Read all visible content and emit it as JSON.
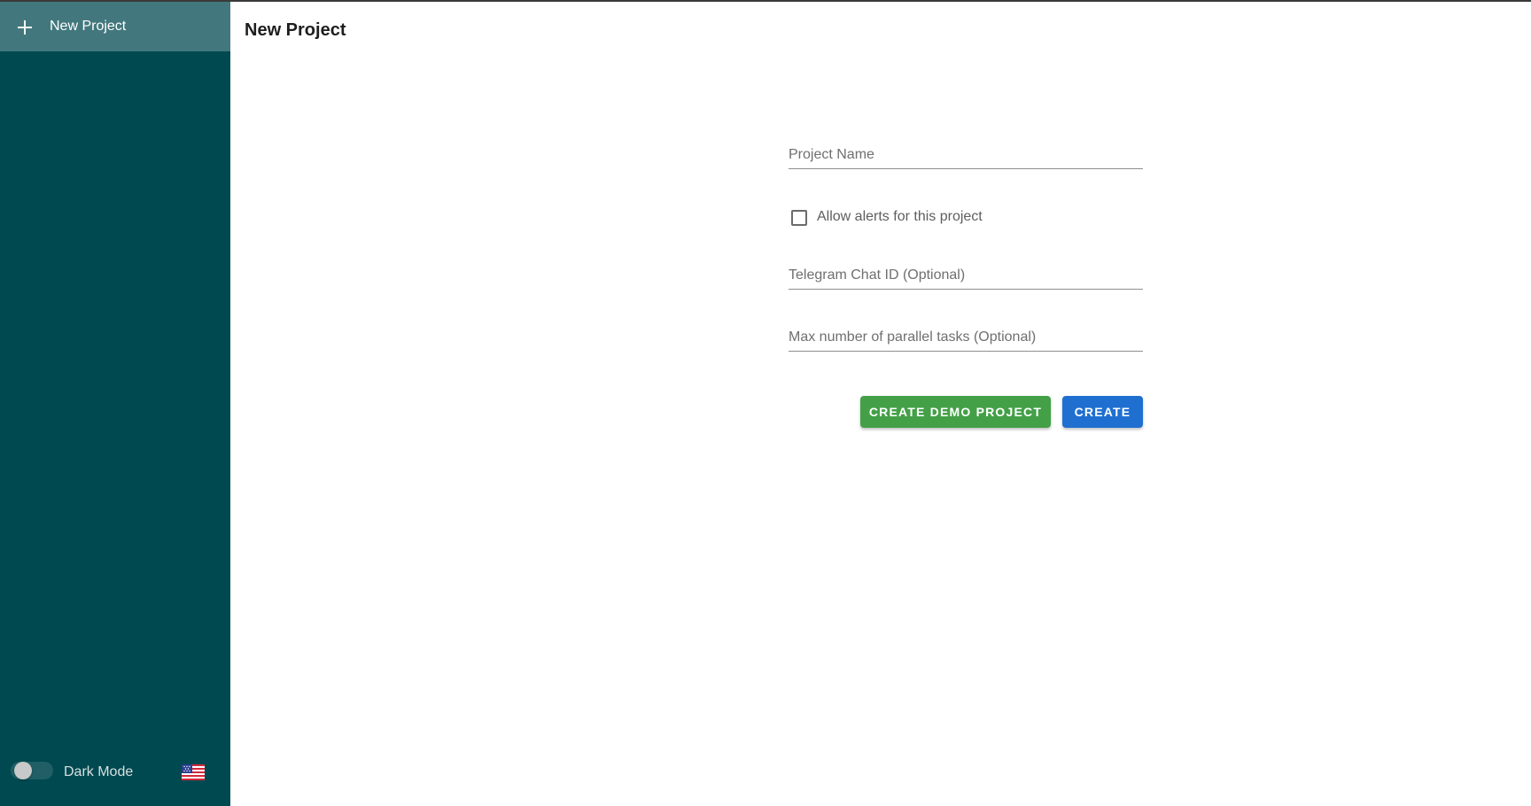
{
  "sidebar": {
    "new_project_label": "New Project",
    "dark_mode_label": "Dark Mode",
    "dark_mode_enabled": false,
    "language_flag": "us-flag-icon"
  },
  "main": {
    "title": "New Project",
    "form": {
      "project_name_placeholder": "Project Name",
      "alerts_label": "Allow alerts for this project",
      "alerts_checked": false,
      "telegram_placeholder": "Telegram Chat ID (Optional)",
      "max_tasks_placeholder": "Max number of parallel tasks (Optional)",
      "demo_button_label": "Create Demo Project",
      "create_button_label": "Create"
    }
  },
  "colors": {
    "sidebar_bg": "#004950",
    "demo_button": "#43a047",
    "create_button": "#1f6fd1"
  }
}
